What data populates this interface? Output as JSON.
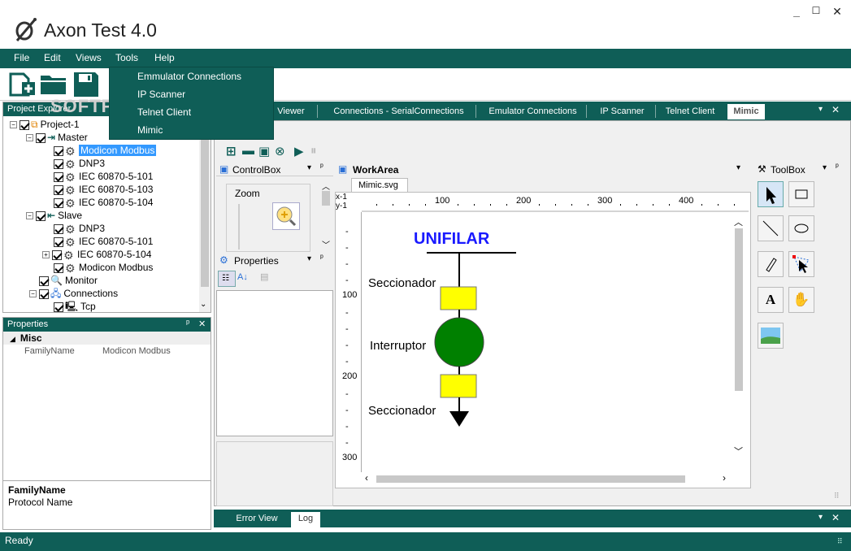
{
  "app": {
    "title": "Axon Test 4.0",
    "minimize": "_",
    "maximize": "☐",
    "close": "✕"
  },
  "menu": {
    "items": [
      "File",
      "Edit",
      "Views",
      "Tools",
      "Help"
    ]
  },
  "tools_menu": {
    "items": [
      "Emmulator Connections",
      "IP Scanner",
      "Telnet Client",
      "Mimic"
    ]
  },
  "watermark": "SOFTPEDIA",
  "project_explorer": {
    "title": "Project Explorer",
    "tree": [
      {
        "label": "Project-1",
        "level": 0
      },
      {
        "label": "Master",
        "level": 1
      },
      {
        "label": "Modicon Modbus",
        "level": 2,
        "selected": true
      },
      {
        "label": "DNP3",
        "level": 2
      },
      {
        "label": "IEC 60870-5-101",
        "level": 2
      },
      {
        "label": "IEC 60870-5-103",
        "level": 2
      },
      {
        "label": "IEC 60870-5-104",
        "level": 2
      },
      {
        "label": "Slave",
        "level": 1
      },
      {
        "label": "DNP3",
        "level": 2
      },
      {
        "label": "IEC 60870-5-101",
        "level": 2
      },
      {
        "label": "IEC 60870-5-104",
        "level": 2
      },
      {
        "label": "Modicon Modbus",
        "level": 2
      },
      {
        "label": "Monitor",
        "level": 1
      },
      {
        "label": "Connections",
        "level": 1
      },
      {
        "label": "Tcp",
        "level": 2
      }
    ]
  },
  "properties_left": {
    "title": "Properties",
    "pin": "ᵖ",
    "close": "✕",
    "group": "Misc",
    "rows": [
      {
        "name": "FamilyName",
        "value": "Modicon Modbus"
      }
    ],
    "desc_title": "FamilyName",
    "desc_text": "Protocol Name"
  },
  "doc_tabs": [
    "Viewer",
    "Connections - SerialConnections",
    "Emulator Connections",
    "IP Scanner",
    "Telnet Client",
    "Mimic"
  ],
  "controlbox": {
    "title": "ControlBox",
    "zoom_label": "Zoom"
  },
  "properties_mid": {
    "title": "Properties"
  },
  "workarea": {
    "title": "WorkArea",
    "file_tab": "Mimic.svg",
    "x_label": "x-1",
    "y_label": "y-1",
    "x_ticks": [
      "100",
      "200",
      "300",
      "400"
    ],
    "y_ticks": [
      "100",
      "200",
      "300"
    ]
  },
  "diagram": {
    "title": "UNIFILAR",
    "labels": [
      "Seccionador",
      "Interruptor",
      "Seccionador"
    ],
    "colors": {
      "title": "#1a1aff",
      "switch": "#ffff00",
      "breaker": "#008000"
    }
  },
  "toolbox": {
    "title": "ToolBox",
    "tools": [
      "pointer",
      "rectangle",
      "line",
      "ellipse",
      "pencil",
      "node-edit",
      "text",
      "hand",
      "image"
    ],
    "text_tool": "A"
  },
  "bottom_tabs": [
    "Error View",
    "Log"
  ],
  "status": {
    "text": "Ready"
  }
}
